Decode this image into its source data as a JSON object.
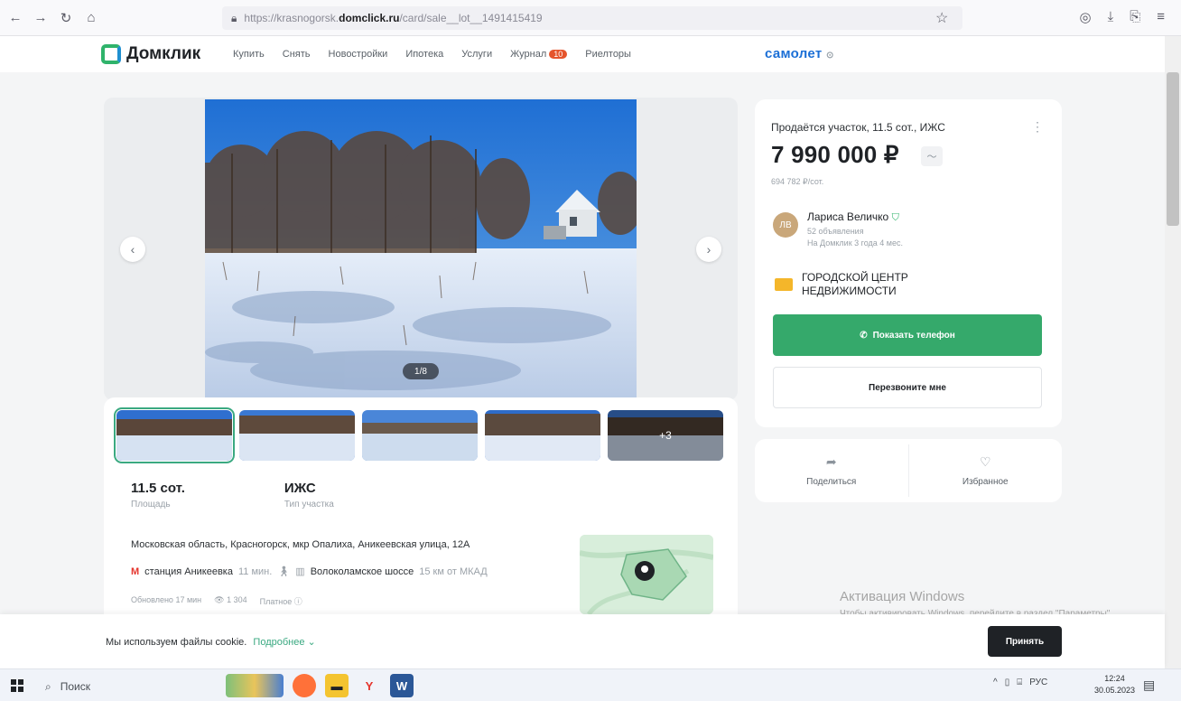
{
  "browser": {
    "url_prefix": "https://krasnogorsk.",
    "url_domain": "domclick.ru",
    "url_suffix": "/card/sale__lot__1491415419"
  },
  "header": {
    "logo": "Домклик",
    "nav": [
      "Купить",
      "Снять",
      "Новостройки",
      "Ипотека",
      "Услуги",
      "Журнал",
      "Риелторы"
    ],
    "journal_badge": "10",
    "partner": "самолет"
  },
  "gallery": {
    "counter": "1/8"
  },
  "thumbnails": {
    "more_label": "+3"
  },
  "facts": [
    {
      "value": "11.5 сот.",
      "label": "Площадь"
    },
    {
      "value": "ИЖС",
      "label": "Тип участка"
    }
  ],
  "location": {
    "address": "Московская область, Красногорск, мкр Опалиха, Аникеевская улица, 12А",
    "metro_name": "станция Аникеевка",
    "metro_time": "11 мин.",
    "highway_name": "Волоколамское шоссе",
    "highway_distance": "15 км от МКАД"
  },
  "meta": {
    "updated": "Обновлено 17 мин",
    "views": "1 304",
    "paid": "Платное"
  },
  "offer": {
    "title": "Продаётся участок, 11.5 сот., ИЖС",
    "price": "7 990 000 ₽",
    "price_per_unit": "694 782 ₽/сот.",
    "more_icon": "⋮",
    "trend_icon": "〜"
  },
  "agent": {
    "initials": "ЛВ",
    "name": "Лариса Величко",
    "listings": "52 объявления",
    "tenure": "На Домклик 3 года 4 мес."
  },
  "agency": {
    "name_line1": "Городской центр",
    "name_line2": "недвижимости"
  },
  "buttons": {
    "show_phone": "Показать телефон",
    "callback": "Перезвоните мне",
    "share": "Поделиться",
    "favorite": "Избранное",
    "accept": "Принять"
  },
  "cookie": {
    "text": "Мы используем файлы cookie.",
    "link": "Подробнее"
  },
  "activation": {
    "title": "Активация Windows",
    "subtitle": "Чтобы активировать Windows, перейдите в раздел \"Параметры\"."
  },
  "taskbar": {
    "search": "Поиск",
    "lang": "РУС",
    "time": "12:24",
    "date": "30.05.2023"
  },
  "colors": {
    "accent_green": "#35a96b",
    "metro_red": "#e5342c",
    "brand_blue": "#1b6fd6"
  }
}
